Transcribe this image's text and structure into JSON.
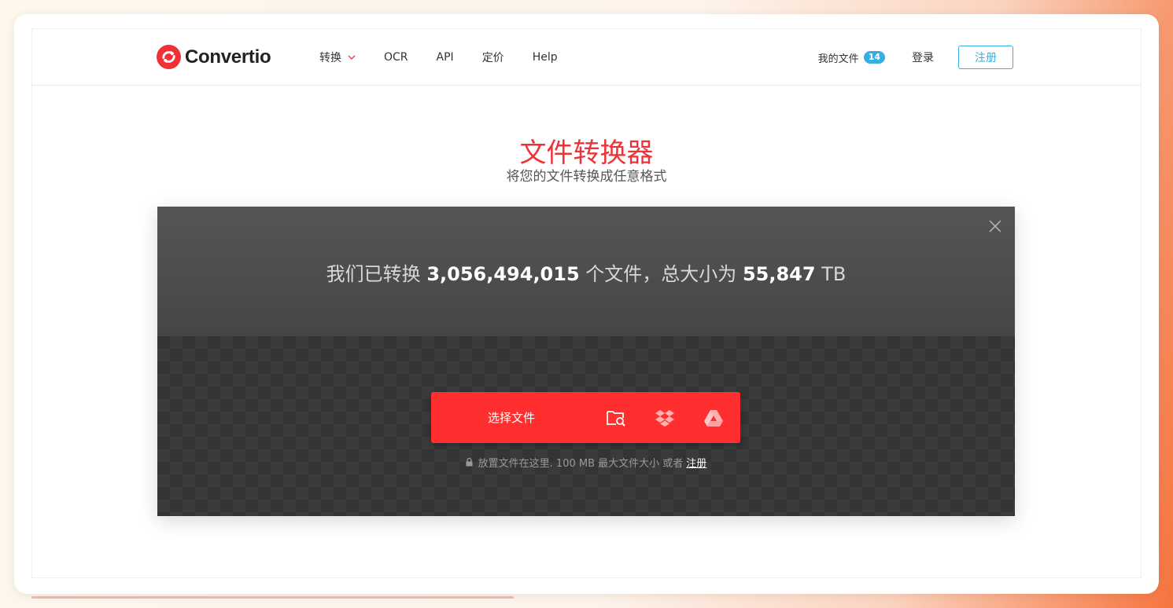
{
  "brand": {
    "name": "Convertio"
  },
  "nav": {
    "items": [
      {
        "label": "转换",
        "has_dropdown": true
      },
      {
        "label": "OCR"
      },
      {
        "label": "API"
      },
      {
        "label": "定价"
      },
      {
        "label": "Help"
      }
    ],
    "my_files_label": "我的文件",
    "my_files_count": "14",
    "login_label": "登录",
    "signup_label": "注册"
  },
  "hero": {
    "title": "文件转换器",
    "subtitle": "将您的文件转换成任意格式"
  },
  "stats": {
    "prefix": "我们已转换",
    "files_count": "3,056,494,015",
    "middle": "个文件，总大小为",
    "total_size": "55,847",
    "unit": "TB"
  },
  "upload": {
    "select_label": "选择文件",
    "sources": [
      "folder-search-icon",
      "dropbox-icon",
      "google-drive-icon"
    ],
    "hint_text": "放置文件在这里. 100 MB 最大文件大小 或者",
    "hint_link": "注册"
  },
  "colors": {
    "accent_red": "#ff2f2f",
    "title_red": "#ee3338",
    "link_blue": "#37aee2"
  }
}
